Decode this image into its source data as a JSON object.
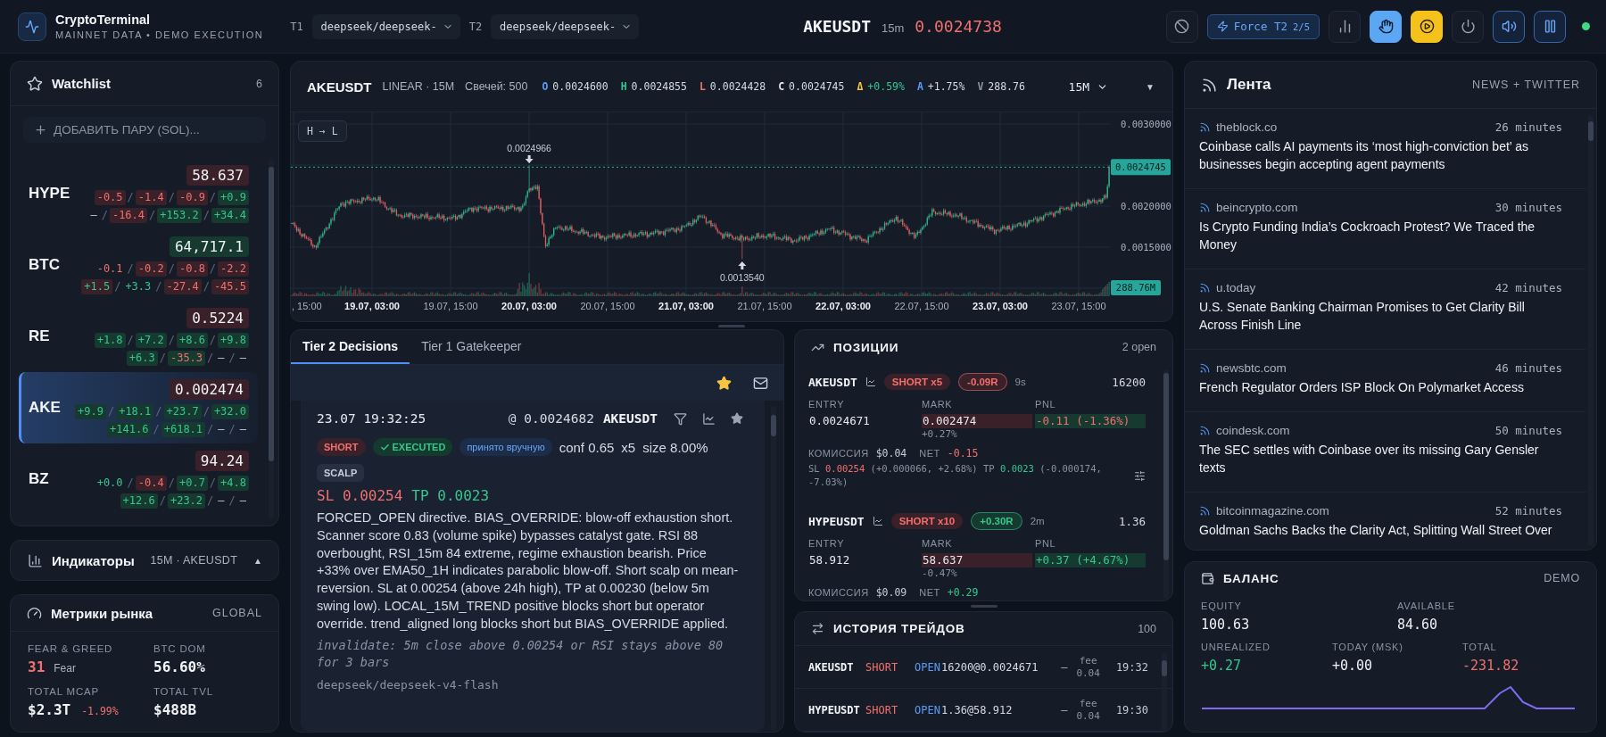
{
  "app": {
    "title": "CryptoTerminal",
    "subtitle": "MAINNET DATA • DEMO EXECUTION"
  },
  "model_selects": [
    {
      "label": "T1",
      "value": "deepseek/deepseek-"
    },
    {
      "label": "T2",
      "value": "deepseek/deepseek-"
    }
  ],
  "ticker": {
    "symbol": "AKEUSDT",
    "interval": "15m",
    "price": "0.0024738",
    "negative": true
  },
  "toolbar": [
    {
      "kind": "block",
      "active": false
    },
    {
      "kind": "force",
      "active": true,
      "label": "Force",
      "tier": "T2",
      "count": "2/5"
    },
    {
      "kind": "stats",
      "active": false
    },
    {
      "kind": "hand",
      "active": true
    },
    {
      "kind": "play",
      "active": true
    },
    {
      "kind": "power",
      "active": false
    },
    {
      "kind": "sound",
      "active": true
    },
    {
      "kind": "pause",
      "active": true
    }
  ],
  "connection": {
    "online": true
  },
  "watchlist": {
    "title": "Watchlist",
    "count": "6",
    "add_placeholder": "ДОБАВИТЬ ПАРУ (SOL)...",
    "separator": "/",
    "items": [
      {
        "symbol": "HYPE",
        "price": "58.637",
        "negative": true,
        "selected": false,
        "changes": [
          {
            "value": "-0.5",
            "kind": "down",
            "color": "#3a2129"
          },
          {
            "value": "-1.4",
            "kind": "down",
            "color": "#3a2129"
          },
          {
            "value": "-0.9",
            "kind": "down",
            "color": "#3a2129"
          },
          {
            "value": "+0.9",
            "kind": "up",
            "color": "#163a30"
          },
          {
            "value": "—",
            "kind": "flat"
          },
          {
            "value": "-16.4",
            "kind": "down",
            "color": "#3a2129"
          },
          {
            "value": "+153.2",
            "kind": "up",
            "color": "#163a30"
          },
          {
            "value": "+34.4",
            "kind": "up",
            "color": "#163a30"
          }
        ]
      },
      {
        "symbol": "BTC",
        "price": "64,717.1",
        "negative": false,
        "selected": false,
        "changes": [
          {
            "value": "-0.1",
            "kind": "down"
          },
          {
            "value": "-0.2",
            "kind": "down",
            "color": "#3a2129"
          },
          {
            "value": "-0.8",
            "kind": "down",
            "color": "#3a2129"
          },
          {
            "value": "-2.2",
            "kind": "down",
            "color": "#3a2129"
          },
          {
            "value": "+1.5",
            "kind": "up",
            "color": "#3a2129"
          },
          {
            "value": "+3.3",
            "kind": "up"
          },
          {
            "value": "-27.4",
            "kind": "down",
            "color": "#3a2129"
          },
          {
            "value": "-45.5",
            "kind": "down",
            "color": "#3a2129"
          }
        ]
      },
      {
        "symbol": "RE",
        "price": "0.5224",
        "negative": true,
        "selected": false,
        "changes": [
          {
            "value": "+1.8",
            "kind": "up",
            "color": "#163a30"
          },
          {
            "value": "+7.2",
            "kind": "up",
            "color": "#163a30"
          },
          {
            "value": "+8.6",
            "kind": "up",
            "color": "#163a30"
          },
          {
            "value": "+9.8",
            "kind": "up",
            "color": "#163a30"
          },
          {
            "value": "+6.3",
            "kind": "up",
            "color": "#163a30"
          },
          {
            "value": "-35.3",
            "kind": "down",
            "color": "#163a30"
          },
          {
            "value": "—",
            "kind": "flat"
          },
          {
            "value": "—",
            "kind": "flat"
          }
        ]
      },
      {
        "symbol": "AKE",
        "price": "0.002474",
        "negative": true,
        "selected": true,
        "changes": [
          {
            "value": "+9.9",
            "kind": "up",
            "color": "#163a30"
          },
          {
            "value": "+18.1",
            "kind": "up",
            "color": "#163a30"
          },
          {
            "value": "+23.7",
            "kind": "up",
            "color": "#163a30"
          },
          {
            "value": "+32.0",
            "kind": "up",
            "color": "#163a30"
          },
          {
            "value": "+141.6",
            "kind": "up",
            "color": "#163a30"
          },
          {
            "value": "+618.1",
            "kind": "up",
            "color": "#163a30"
          },
          {
            "value": "—",
            "kind": "flat"
          },
          {
            "value": "—",
            "kind": "flat"
          }
        ]
      },
      {
        "symbol": "BZ",
        "price": "94.24",
        "negative": true,
        "selected": false,
        "changes": [
          {
            "value": "+0.0",
            "kind": "up"
          },
          {
            "value": "-0.4",
            "kind": "down",
            "color": "#3a2129"
          },
          {
            "value": "+0.7",
            "kind": "up",
            "color": "#163a30"
          },
          {
            "value": "+4.8",
            "kind": "up",
            "color": "#163a30"
          },
          {
            "value": "+12.6",
            "kind": "up",
            "color": "#163a30"
          },
          {
            "value": "+23.2",
            "kind": "up",
            "color": "#163a30"
          },
          {
            "value": "—",
            "kind": "flat"
          },
          {
            "value": "—",
            "kind": "flat"
          }
        ]
      }
    ]
  },
  "indicators": {
    "title": "Индикаторы",
    "context": "15M · AKEUSDT",
    "toggle": "▲"
  },
  "market": {
    "title": "Метрики рынка",
    "scope": "GLOBAL",
    "items": [
      {
        "label": "FEAR & GREED",
        "value": "31",
        "kind": "down",
        "note": "Fear"
      },
      {
        "label": "BTC DOM",
        "value": "56.60%",
        "kind": "flat"
      },
      {
        "label": "TOTAL MCAP",
        "value": "$2.3T",
        "kind": "flat",
        "change": "-1.99%",
        "change_negative": true
      },
      {
        "label": "TOTAL TVL",
        "value": "$488B",
        "kind": "flat"
      }
    ]
  },
  "chart": {
    "symbol": "AKEUSDT",
    "market": "LINEAR · 15M",
    "candles": "Свечей: 500",
    "stats": [
      {
        "key": "O",
        "value": "0.0024600",
        "color": "#5b9cf6",
        "kind": "flat"
      },
      {
        "key": "H",
        "value": "0.0024855",
        "color": "#35c78e",
        "kind": "flat"
      },
      {
        "key": "L",
        "value": "0.0024428",
        "color": "#f0706e",
        "kind": "flat"
      },
      {
        "key": "C",
        "value": "0.0024745",
        "color": "#e6e9ef",
        "kind": "flat"
      },
      {
        "key": "Δ",
        "value": "+0.59%",
        "color": "#f5c542",
        "kind": "up"
      },
      {
        "key": "A",
        "value": "+1.75%",
        "color": "#5b9cf6",
        "kind": "flat"
      },
      {
        "key": "V",
        "value": "288.76",
        "color": "#8a94a6",
        "kind": "flat"
      }
    ],
    "interval": "15M",
    "menu": "▼",
    "range_button": "H → L",
    "y_labels": [
      "0.0030000",
      "0.0020000",
      "0.0015000"
    ],
    "last_price": "0.0024745",
    "volume_tag": "288.76M",
    "high_marker": "0.0024966",
    "low_marker": "0.0013540",
    "x_labels": [
      {
        "text": ", 15:00",
        "major": false
      },
      {
        "text": "19.07, 03:00",
        "major": true
      },
      {
        "text": "19.07, 15:00",
        "major": false
      },
      {
        "text": "20.07, 03:00",
        "major": true
      },
      {
        "text": "20.07, 15:00",
        "major": false
      },
      {
        "text": "21.07, 03:00",
        "major": true
      },
      {
        "text": "21.07, 15:00",
        "major": false
      },
      {
        "text": "22.07, 03:00",
        "major": true
      },
      {
        "text": "22.07, 15:00",
        "major": false
      },
      {
        "text": "23.07, 03:00",
        "major": true
      },
      {
        "text": "23.07, 15:00",
        "major": false
      }
    ]
  },
  "decisions": {
    "tabs": [
      {
        "label": "Tier 2 Decisions",
        "selected": true
      },
      {
        "label": "Tier 1 Gatekeeper",
        "selected": false
      }
    ],
    "filters": [
      {
        "kind": "star",
        "active": true
      },
      {
        "kind": "mail",
        "active": false
      }
    ],
    "card": {
      "time": "23.07 19:32:25",
      "price": "@ 0.0024682",
      "symbol": "AKEUSDT",
      "starred": false,
      "badges": [
        {
          "kind": "side",
          "text": "SHORT"
        },
        {
          "kind": "status",
          "text": "EXECUTED"
        },
        {
          "kind": "source",
          "text": "принято вручную"
        }
      ],
      "params": [
        "conf 0.65",
        "x5",
        "size 8.00%"
      ],
      "tags": [
        {
          "kind": "tag",
          "text": "SCALP"
        }
      ],
      "stop_loss": {
        "label": "SL",
        "value": "0.00254"
      },
      "take_profit": {
        "label": "TP",
        "value": "0.0023"
      },
      "reason": "FORCED_OPEN directive. BIAS_OVERRIDE: blow-off exhaustion short. Scanner score 0.83 (volume spike) bypasses catalyst gate. RSI 88 overbought, RSI_15m 84 extreme, regime exhaustion bearish. Price +33% over EMA50_1H indicates parabolic blow-off. Short scalp on mean-reversion. SL at 0.00254 (above 24h high), TP at 0.00230 (below 5m swing low). LOCAL_15M_TREND positive blocks short but operator override. trend_aligned long blocks short but BIAS_OVERRIDE applied.",
      "invalidate": "invalidate: 5m close above 0.00254 or RSI stays above 80 for 3 bars",
      "model": "deepseek/deepseek-v4-flash"
    }
  },
  "positions": {
    "title": "ПОЗИЦИИ",
    "count": "2 open",
    "items": [
      {
        "symbol": "AKEUSDT",
        "side": "SHORT x5",
        "short": true,
        "r_multiple": "-0.09R",
        "r_negative": true,
        "age": "9s",
        "qty": "16200",
        "entry_label": "ENTRY",
        "entry": "0.0024671",
        "mark_label": "MARK",
        "mark": "0.002474",
        "mark_change": "+0.27%",
        "pnl_label": "PNL",
        "pnl": "-0.11 (-1.36%)",
        "pnl_negative": true,
        "fee_label": "КОМИССИЯ",
        "fee": "$0.04",
        "net_label": "NET",
        "net": "-0.15",
        "net_negative": true,
        "levels": {
          "sl_label": "SL",
          "sl": "0.00254",
          "sl_detail": "(+0.000066, +2.68%)",
          "tp_label": "TP",
          "tp": "0.0023",
          "tp_detail": "(-0.000174, -7.03%)"
        }
      },
      {
        "symbol": "HYPEUSDT",
        "side": "SHORT x10",
        "short": true,
        "r_multiple": "+0.30R",
        "r_negative": false,
        "age": "2m",
        "qty": "1.36",
        "entry_label": "ENTRY",
        "entry": "58.912",
        "mark_label": "MARK",
        "mark": "58.637",
        "mark_change": "-0.47%",
        "pnl_label": "PNL",
        "pnl": "+0.37 (+4.67%)",
        "pnl_negative": false,
        "fee_label": "КОМИССИЯ",
        "fee": "$0.09",
        "net_label": "NET",
        "net": "+0.29",
        "net_negative": false
      }
    ]
  },
  "history": {
    "title": "ИСТОРИЯ ТРЕЙДОВ",
    "count": "100",
    "rows": [
      {
        "symbol": "AKEUSDT",
        "side": "SHORT",
        "short": true,
        "action": "OPEN",
        "fill": "16200@0.0024671",
        "pnl": "—",
        "fee_label": "fee",
        "fee": "0.04",
        "time": "19:32"
      },
      {
        "symbol": "HYPEUSDT",
        "side": "SHORT",
        "short": true,
        "action": "OPEN",
        "fill": "1.36@58.912",
        "pnl": "—",
        "fee_label": "fee",
        "fee": "0.04",
        "time": "19:30"
      }
    ]
  },
  "news": {
    "title": "Лента",
    "sources": "NEWS + TWITTER",
    "items": [
      {
        "source": "theblock.co",
        "time": "26 minutes",
        "title": "Coinbase calls AI payments its ‘most high-conviction bet’ as businesses begin accepting agent payments"
      },
      {
        "source": "beincrypto.com",
        "time": "30 minutes",
        "title": "Is Crypto Funding India’s Cockroach Protest? We Traced the Money"
      },
      {
        "source": "u.today",
        "time": "42 minutes",
        "title": "U.S. Senate Banking Chairman Promises to Get Clarity Bill Across Finish Line"
      },
      {
        "source": "newsbtc.com",
        "time": "46 minutes",
        "title": "French Regulator Orders ISP Block On Polymarket Access"
      },
      {
        "source": "coindesk.com",
        "time": "50 minutes",
        "title": "The SEC settles with Coinbase over its missing Gary Gensler texts"
      },
      {
        "source": "bitcoinmagazine.com",
        "time": "52 minutes",
        "title": "Goldman Sachs Backs the Clarity Act, Splitting Wall Street Over"
      }
    ]
  },
  "balance": {
    "title": "БАЛАНС",
    "mode": "DEMO",
    "stats": [
      {
        "label": "EQUITY",
        "value": "100.63",
        "kind": "flat"
      },
      {
        "label": "AVAILABLE",
        "value": "84.60",
        "kind": "flat"
      },
      {
        "label": "UNREALIZED",
        "value": "+0.27",
        "kind": "up"
      },
      {
        "label": "TODAY (MSK)",
        "value": "+0.00",
        "kind": "flat"
      },
      {
        "label": "TOTAL",
        "value": "-231.82",
        "kind": "down"
      }
    ]
  }
}
